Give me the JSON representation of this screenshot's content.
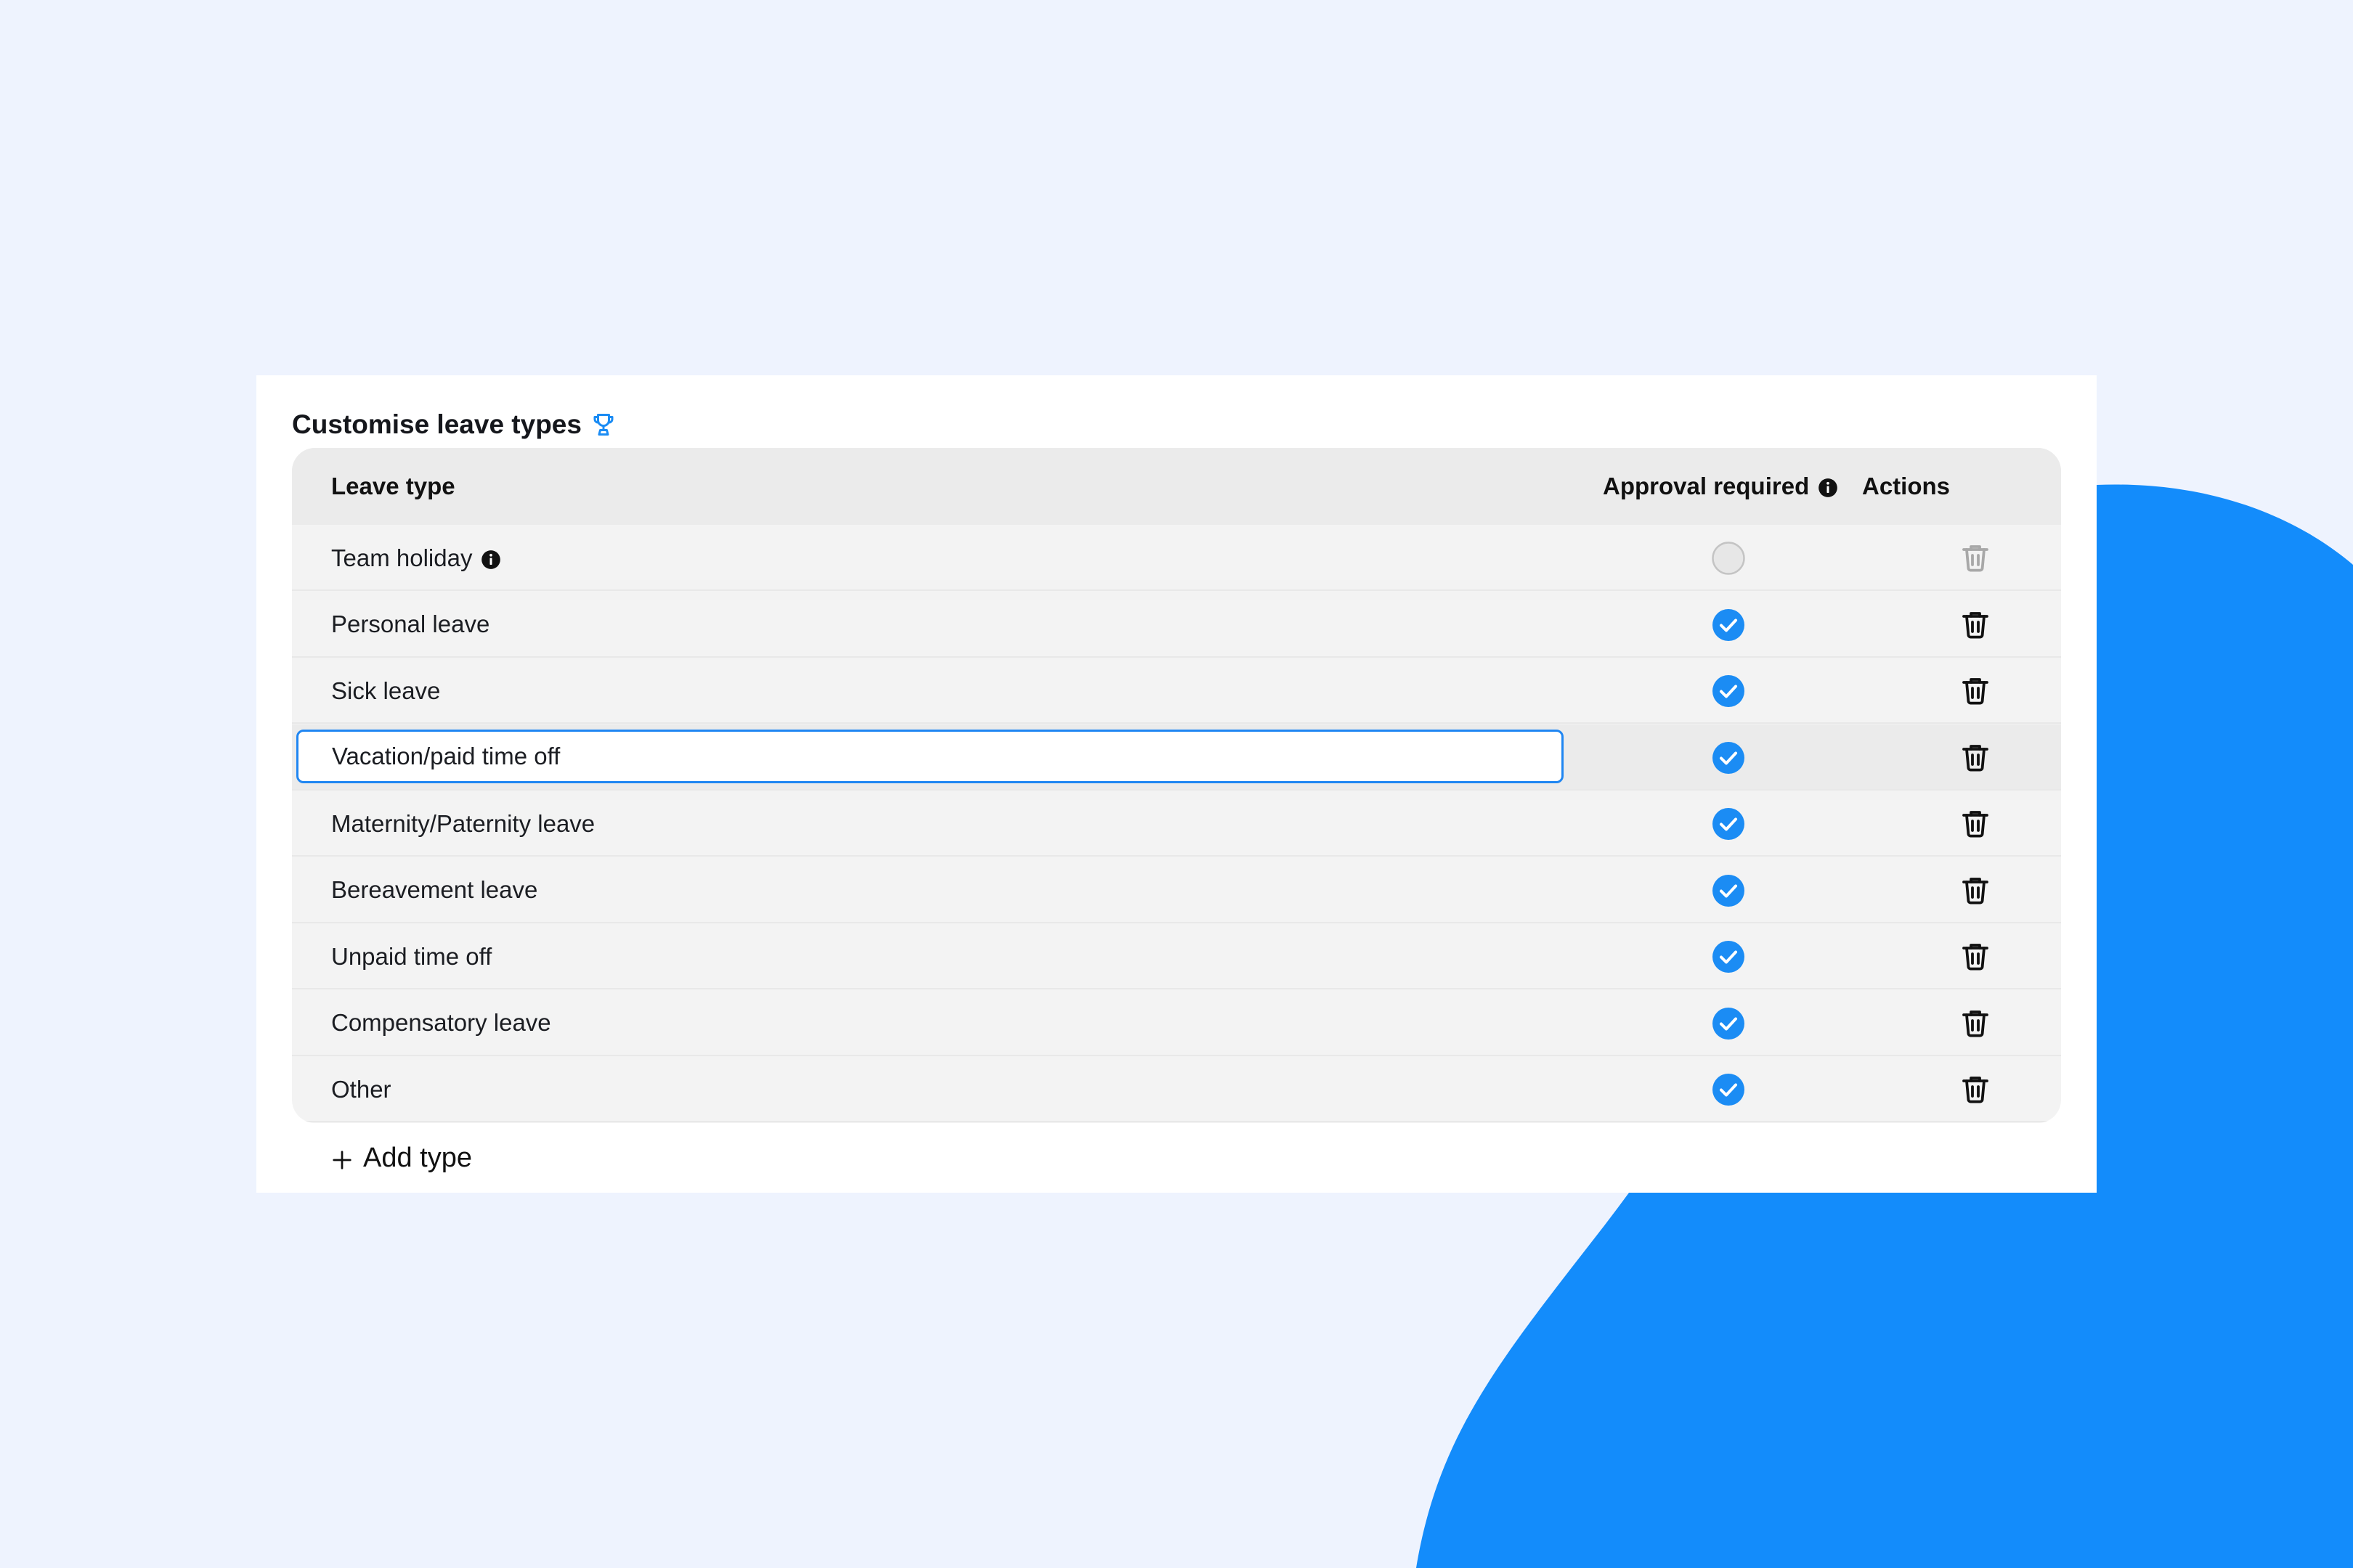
{
  "colors": {
    "background": "#eef3fe",
    "accent_blob": "#138cfb",
    "check_blue": "#1b8cf4",
    "panel": "#ffffff",
    "table_bg": "#f3f3f3",
    "header_bg": "#ebebeb"
  },
  "panel": {
    "title": "Customise leave types",
    "title_icon": "trophy-icon"
  },
  "table": {
    "columns": {
      "leave_type": "Leave type",
      "approval_required": "Approval required",
      "approval_info_icon": "info-icon",
      "actions": "Actions"
    },
    "rows": [
      {
        "name": "Team holiday",
        "has_info_icon": true,
        "approval_required": false,
        "delete_disabled": true,
        "editing": false
      },
      {
        "name": "Personal leave",
        "has_info_icon": false,
        "approval_required": true,
        "delete_disabled": false,
        "editing": false
      },
      {
        "name": "Sick leave",
        "has_info_icon": false,
        "approval_required": true,
        "delete_disabled": false,
        "editing": false
      },
      {
        "name": "Vacation/paid time off",
        "has_info_icon": false,
        "approval_required": true,
        "delete_disabled": false,
        "editing": true
      },
      {
        "name": "Maternity/Paternity leave",
        "has_info_icon": false,
        "approval_required": true,
        "delete_disabled": false,
        "editing": false
      },
      {
        "name": "Bereavement leave",
        "has_info_icon": false,
        "approval_required": true,
        "delete_disabled": false,
        "editing": false
      },
      {
        "name": "Unpaid time off",
        "has_info_icon": false,
        "approval_required": true,
        "delete_disabled": false,
        "editing": false
      },
      {
        "name": "Compensatory leave",
        "has_info_icon": false,
        "approval_required": true,
        "delete_disabled": false,
        "editing": false
      },
      {
        "name": "Other",
        "has_info_icon": false,
        "approval_required": true,
        "delete_disabled": false,
        "editing": false
      }
    ]
  },
  "add_type": {
    "label": "Add type",
    "icon": "plus-icon"
  }
}
